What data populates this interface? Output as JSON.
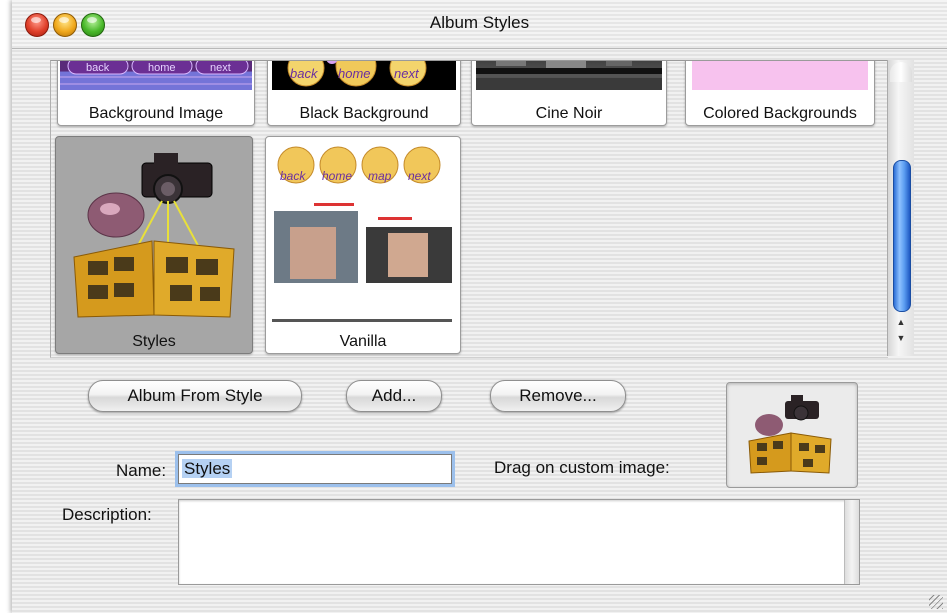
{
  "window": {
    "title": "Album Styles"
  },
  "gallery": {
    "tiles": [
      {
        "label": "Background Image",
        "thumb_text": [
          "back",
          "home",
          "next"
        ]
      },
      {
        "label": "Black Background",
        "thumb_text": [
          "back",
          "home",
          "next"
        ]
      },
      {
        "label": "Cine Noir"
      },
      {
        "label": "Colored Backgrounds"
      },
      {
        "label": "Styles",
        "selected": true
      },
      {
        "label": "Vanilla",
        "thumb_text": [
          "back",
          "home",
          "map",
          "next"
        ]
      }
    ]
  },
  "buttons": {
    "album_from_style": "Album From Style",
    "add": "Add...",
    "remove": "Remove..."
  },
  "form": {
    "name_label": "Name:",
    "name_value": "Styles",
    "drag_label": "Drag on custom image:",
    "description_label": "Description:",
    "description_value": ""
  },
  "colors": {
    "accent": "#3a82e6",
    "selected_tile": "#a6a6a6"
  },
  "icons": [
    "close-icon",
    "minimize-icon",
    "zoom-icon",
    "resize-grip-icon",
    "scroll-up-arrow-icon",
    "scroll-down-arrow-icon"
  ]
}
